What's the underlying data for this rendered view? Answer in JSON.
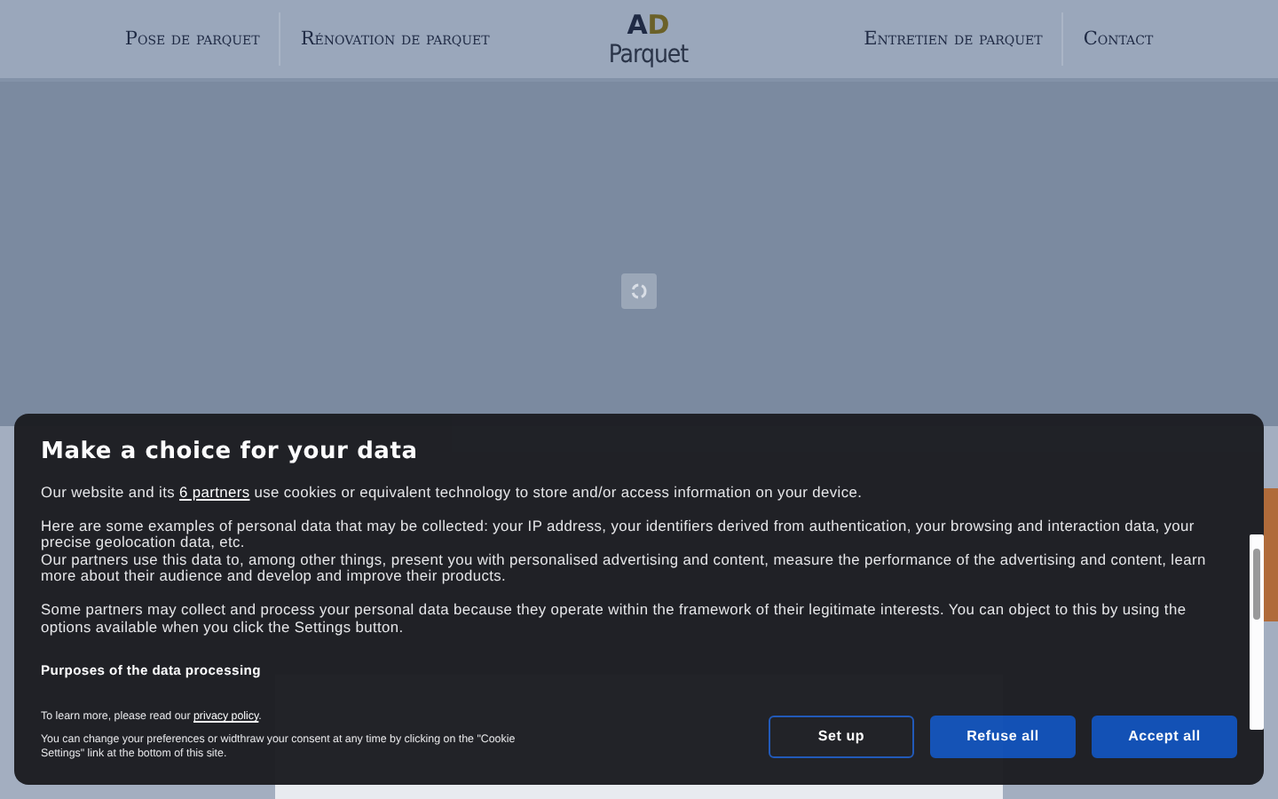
{
  "header": {
    "nav_left": [
      "Pose de parquet",
      "Rénovation de parquet"
    ],
    "logo": {
      "initials": [
        "A",
        "D"
      ],
      "name": "Parquet"
    },
    "nav_right": [
      "Entretien de parquet",
      "Contact"
    ]
  },
  "dialog": {
    "title": "Make a choice for your data",
    "intro": {
      "before": "Our website and its ",
      "link": "6 partners",
      "after": " use cookies or equivalent technology to store and/or access information on your device."
    },
    "paragraphs": [
      "Here are some examples of personal data that may be collected: your IP address, your identifiers derived from authentication, your browsing and interaction data, your precise geolocation data, etc.",
      "Our partners use this data to, among other things, present you with personalised advertising and content, measure the performance of the advertising and content, learn more about their audience and develop and improve their products.",
      "Some partners may collect and process your personal data because they operate within the framework of their legitimate interests. You can object to this by using the options available when you click the Settings button."
    ],
    "purposes_heading": "Purposes of the data processing",
    "privacy": {
      "before": "To learn more, please read our ",
      "link": "privacy policy",
      "after": "."
    },
    "consent_note": "You can change your preferences or widthraw your consent at any time by clicking on the \"Cookie Settings\" link at the bottom of this site.",
    "buttons": [
      {
        "label": "Set up",
        "kind": "outline"
      },
      {
        "label": "Refuse all",
        "kind": "filled"
      },
      {
        "label": "Accept all",
        "kind": "filled"
      }
    ]
  }
}
